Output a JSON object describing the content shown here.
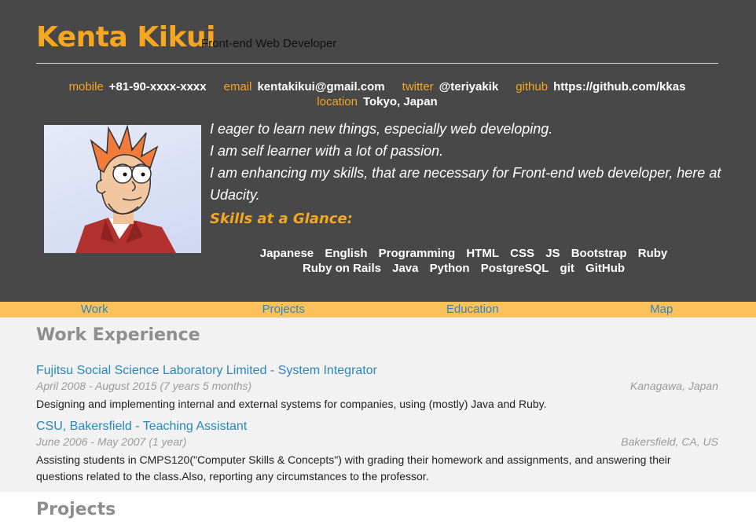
{
  "header": {
    "name": "Kenta Kikui",
    "role": "Front-end Web Developer",
    "contacts": [
      {
        "label": "mobile",
        "value": "+81-90-xxxx-xxxx"
      },
      {
        "label": "email",
        "value": "kentakikui@gmail.com"
      },
      {
        "label": "twitter",
        "value": "@teriyakik"
      },
      {
        "label": "github",
        "value": "https://github.com/kkas"
      },
      {
        "label": "location",
        "value": "Tokyo, Japan"
      }
    ],
    "welcome": [
      " I eager to learn new things, especially web developing.",
      "I am self learner with a lot of passion.",
      "I am enhancing my skills, that are necessary for Front-end web developer, here at Udacity."
    ],
    "skills_heading": "Skills at a Glance:",
    "skills": [
      "Japanese",
      "English",
      "Programming",
      "HTML",
      "CSS",
      "JS",
      "Bootstrap",
      "Ruby",
      "Ruby on Rails",
      "Java",
      "Python",
      "PostgreSQL",
      "git",
      "GitHub"
    ]
  },
  "nav": [
    "Work",
    "Projects",
    "Education",
    "Map"
  ],
  "work": {
    "heading": "Work Experience",
    "jobs": [
      {
        "title": "Fujitsu Social Science Laboratory Limited - System Integrator",
        "dates": "April 2008 - August 2015 (7 years 5 months)",
        "location": "Kanagawa, Japan",
        "description": "Designing and implementing internal and external systems for companies, using (mostly) Java and Ruby."
      },
      {
        "title": "CSU, Bakersfield - Teaching Assistant",
        "dates": "June 2006 - May 2007 (1 year)",
        "location": "Bakersfield, CA, US",
        "description": "Assisting students in CMPS120(\"Computer Skills & Concepts\") with grading their homework and assignments, and answering their questions related to the class.Also, reporting any circumstances to the professor."
      }
    ]
  },
  "projects": {
    "heading": "Projects"
  },
  "colors": {
    "accent": "#f5a623",
    "header_bg": "#484848",
    "nav_bg": "#fbc15b",
    "link": "#2a87c0",
    "section_bg": "#f2f2f2"
  }
}
